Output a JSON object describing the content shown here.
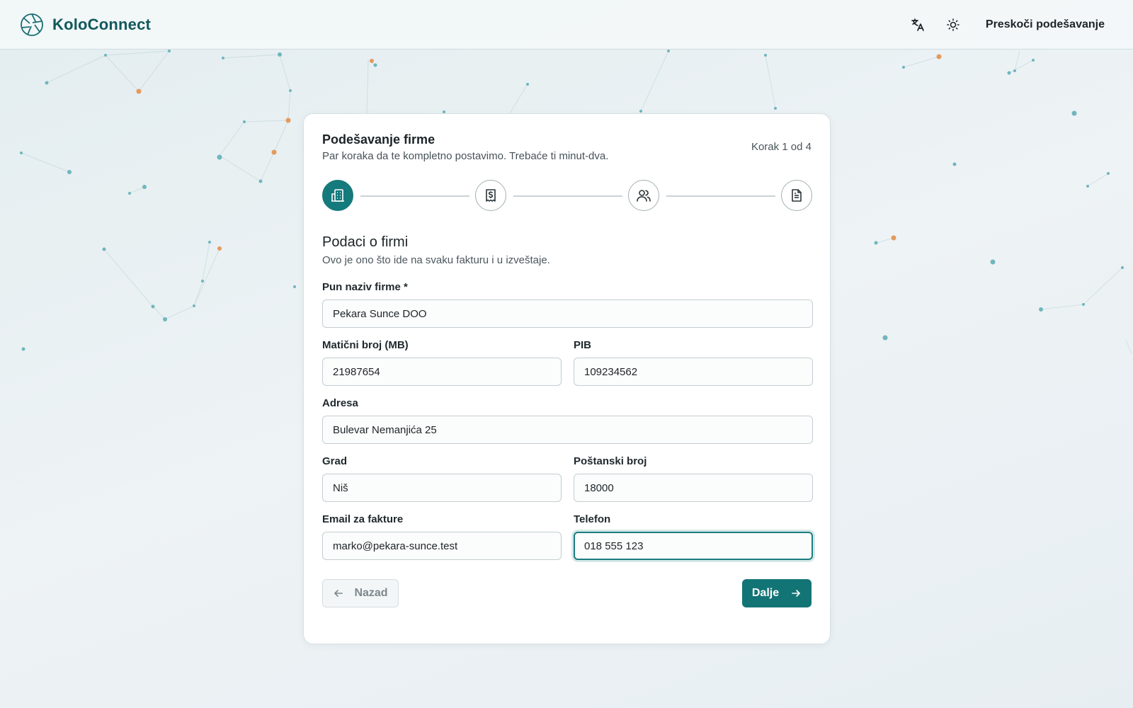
{
  "app": {
    "name": "KoloConnect"
  },
  "header": {
    "skip_label": "Preskoči podešavanje"
  },
  "wizard": {
    "title": "Podešavanje firme",
    "subtitle": "Par koraka da te kompletno postavimo. Trebaće ti minut-dva.",
    "step_counter": "Korak 1 od 4",
    "current_step": 1,
    "total_steps": 4,
    "steps": [
      {
        "icon": "building-icon",
        "active": true
      },
      {
        "icon": "receipt-dollar-icon",
        "active": false
      },
      {
        "icon": "users-icon",
        "active": false
      },
      {
        "icon": "document-icon",
        "active": false
      }
    ]
  },
  "section": {
    "title": "Podaci o firmi",
    "description": "Ovo je ono što ide na svaku fakturu i u izveštaje."
  },
  "form": {
    "company_name": {
      "label": "Pun naziv firme *",
      "value": "Pekara Sunce DOO"
    },
    "mb": {
      "label": "Matični broj (MB)",
      "value": "21987654"
    },
    "pib": {
      "label": "PIB",
      "value": "109234562"
    },
    "address": {
      "label": "Adresa",
      "value": "Bulevar Nemanjića 25"
    },
    "city": {
      "label": "Grad",
      "value": "Niš"
    },
    "postal": {
      "label": "Poštanski broj",
      "value": "18000"
    },
    "email": {
      "label": "Email za fakture",
      "value": "marko@pekara-sunce.test"
    },
    "phone": {
      "label": "Telefon",
      "value": "018 555 123"
    }
  },
  "actions": {
    "back_label": "Nazad",
    "next_label": "Dalje"
  },
  "colors": {
    "accent": "#137476",
    "brand_text": "#12585c",
    "dot_teal": "#6fb6bd",
    "dot_orange": "#e49a5c",
    "background": "#e9f0f2"
  }
}
